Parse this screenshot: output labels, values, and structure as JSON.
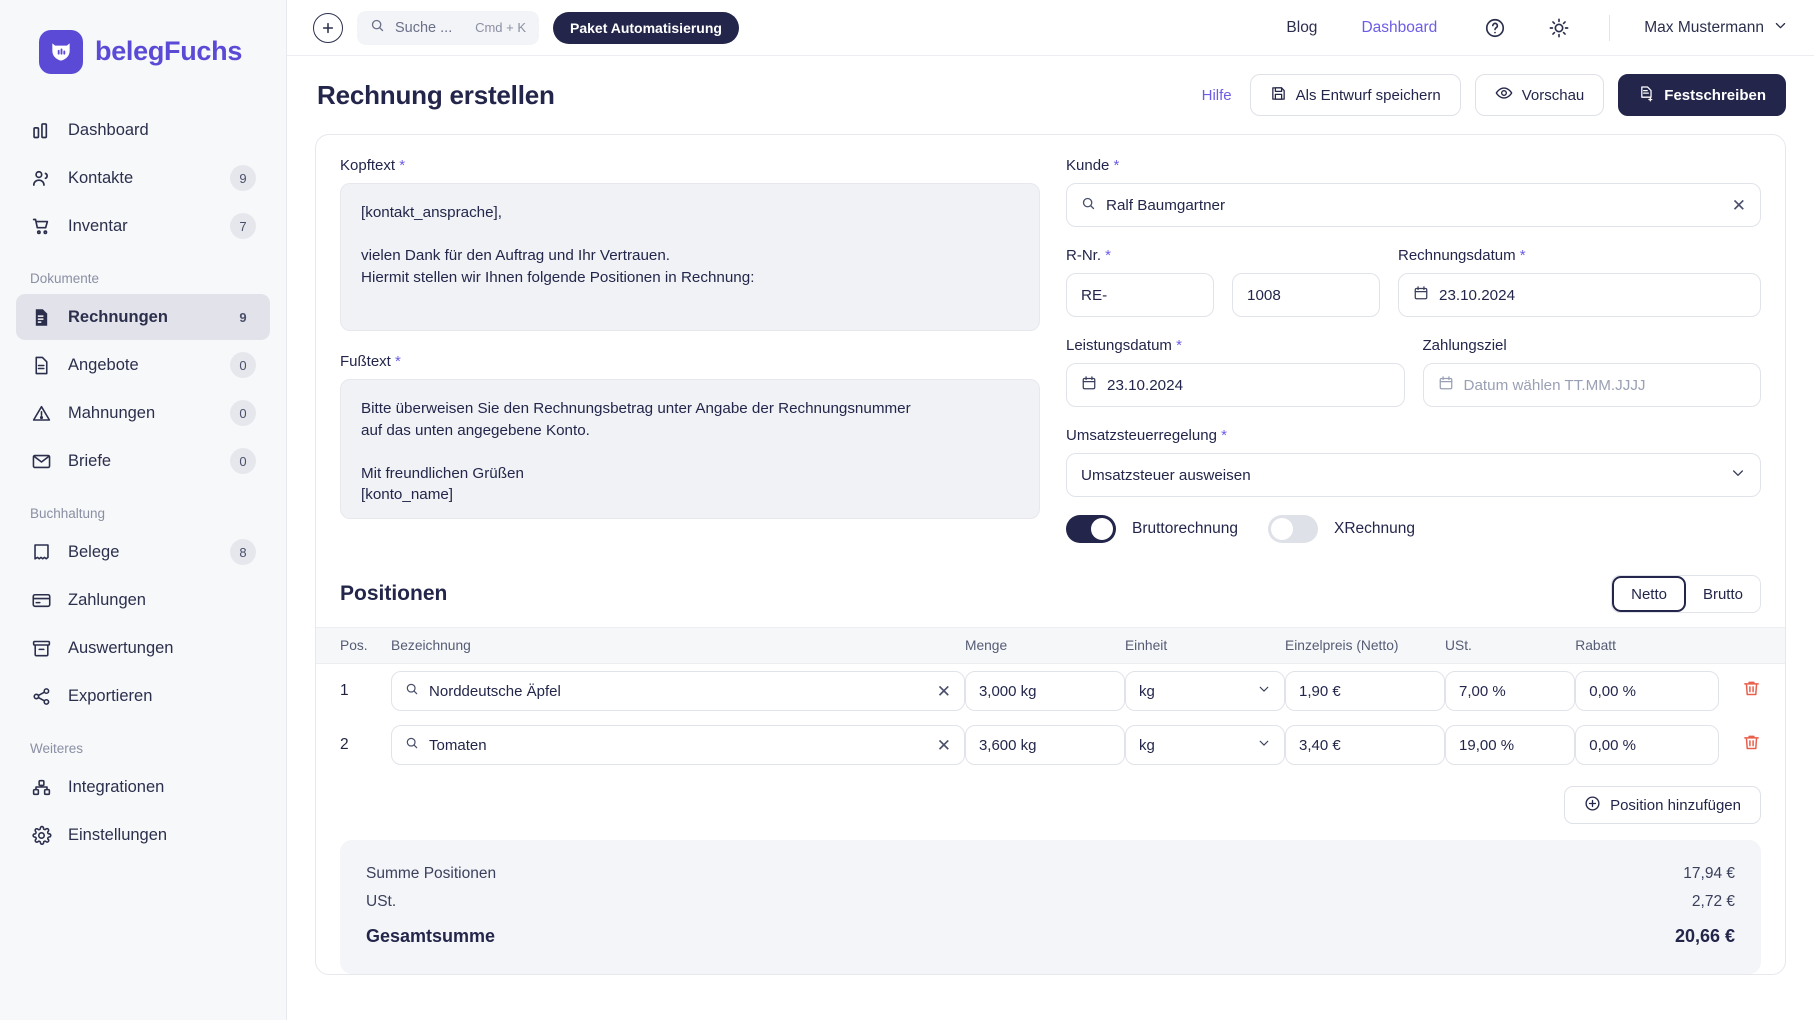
{
  "brand": {
    "name": "belegFuchs",
    "color": "#5b4ad6",
    "dark": "#23264a"
  },
  "sidebar": {
    "top_items": [
      {
        "label": "Dashboard",
        "icon": "chart-bar-icon",
        "badge": ""
      },
      {
        "label": "Kontakte",
        "icon": "users-icon",
        "badge": "9"
      },
      {
        "label": "Inventar",
        "icon": "cart-icon",
        "badge": "7"
      }
    ],
    "sections": [
      {
        "label": "Dokumente",
        "items": [
          {
            "label": "Rechnungen",
            "icon": "invoice-icon",
            "badge": "9",
            "active": true
          },
          {
            "label": "Angebote",
            "icon": "document-icon",
            "badge": "0",
            "active": false
          },
          {
            "label": "Mahnungen",
            "icon": "warning-icon",
            "badge": "0",
            "active": false
          },
          {
            "label": "Briefe",
            "icon": "envelope-icon",
            "badge": "0",
            "active": false
          }
        ]
      },
      {
        "label": "Buchhaltung",
        "items": [
          {
            "label": "Belege",
            "icon": "receipt-icon",
            "badge": "8",
            "active": false
          },
          {
            "label": "Zahlungen",
            "icon": "credit-card-icon",
            "badge": "",
            "active": false
          },
          {
            "label": "Auswertungen",
            "icon": "archive-icon",
            "badge": "",
            "active": false
          },
          {
            "label": "Exportieren",
            "icon": "share-icon",
            "badge": "",
            "active": false
          }
        ]
      },
      {
        "label": "Weiteres",
        "items": [
          {
            "label": "Integrationen",
            "icon": "integrations-icon",
            "badge": "",
            "active": false
          },
          {
            "label": "Einstellungen",
            "icon": "gear-icon",
            "badge": "",
            "active": false
          }
        ]
      }
    ]
  },
  "topbar": {
    "add_icon": "plus-circle-icon",
    "search": {
      "placeholder": "Suche ...",
      "shortcut": "Cmd + K",
      "icon": "search-icon"
    },
    "promo_button": "Paket Automatisierung",
    "links": [
      {
        "label": "Blog",
        "accent": false
      },
      {
        "label": "Dashboard",
        "accent": true
      }
    ],
    "help_icon": "question-circle-icon",
    "theme_icon": "sun-icon",
    "user": "Max Mustermann",
    "user_chevron": "chevron-down-icon"
  },
  "page": {
    "title": "Rechnung erstellen",
    "help_link": "Hilfe",
    "actions": [
      {
        "label": "Als Entwurf speichern",
        "icon": "save-icon",
        "style": "light"
      },
      {
        "label": "Vorschau",
        "icon": "eye-icon",
        "style": "light"
      },
      {
        "label": "Festschreiben",
        "icon": "lock-document-icon",
        "style": "dark"
      }
    ]
  },
  "form": {
    "kopftext": {
      "label": "Kopftext",
      "required": true,
      "value": "[kontakt_ansprache],\n\nvielen Dank für den Auftrag und Ihr Vertrauen.\nHiermit stellen wir Ihnen folgende Positionen in Rechnung:"
    },
    "fusstext": {
      "label": "Fußtext",
      "required": true,
      "value": "Bitte überweisen Sie den Rechnungsbetrag unter Angabe der Rechnungsnummer\nauf das unten angegebene Konto.\n\nMit freundlichen Grüßen\n[konto_name]"
    },
    "kunde": {
      "label": "Kunde",
      "required": true,
      "value": "Ralf Baumgartner",
      "icon": "search-icon",
      "clear_icon": "close-icon"
    },
    "rnr": {
      "label": "R-Nr.",
      "required": true,
      "prefix": "RE-",
      "number": "1008"
    },
    "rechnungsdatum": {
      "label": "Rechnungsdatum",
      "required": true,
      "value": "23.10.2024",
      "icon": "calendar-icon"
    },
    "leistungsdatum": {
      "label": "Leistungsdatum",
      "required": true,
      "value": "23.10.2024",
      "icon": "calendar-icon"
    },
    "zahlungsziel": {
      "label": "Zahlungsziel",
      "required": false,
      "placeholder": "Datum wählen TT.MM.JJJJ",
      "icon": "calendar-icon"
    },
    "umsatzsteuerregelung": {
      "label": "Umsatzsteuerregelung",
      "required": true,
      "value": "Umsatzsteuer ausweisen",
      "chevron": "chevron-down-icon"
    },
    "toggles": [
      {
        "label": "Bruttorechnung",
        "on": true
      },
      {
        "label": "XRechnung",
        "on": false
      }
    ]
  },
  "positions": {
    "title": "Positionen",
    "segmented": {
      "options": [
        "Netto",
        "Brutto"
      ],
      "selected": "Netto"
    },
    "columns": [
      "Pos.",
      "Bezeichnung",
      "Menge",
      "Einheit",
      "Einzelpreis (Netto)",
      "USt.",
      "Rabatt"
    ],
    "rows": [
      {
        "pos": "1",
        "bezeichnung": "Norddeutsche Äpfel",
        "menge": "3,000 kg",
        "einheit": "kg",
        "einzelpreis": "1,90 €",
        "ust": "7,00 %",
        "rabatt": "0,00 %"
      },
      {
        "pos": "2",
        "bezeichnung": "Tomaten",
        "menge": "3,600 kg",
        "einheit": "kg",
        "einzelpreis": "3,40 €",
        "ust": "19,00 %",
        "rabatt": "0,00 %"
      }
    ],
    "add_button": "Position hinzufügen",
    "add_icon": "plus-circle-icon",
    "delete_icon": "trash-icon"
  },
  "totals": [
    {
      "label": "Summe Positionen",
      "value": "17,94 €",
      "grand": false
    },
    {
      "label": "USt.",
      "value": "2,72 €",
      "grand": false
    },
    {
      "label": "Gesamtsumme",
      "value": "20,66 €",
      "grand": true
    }
  ]
}
